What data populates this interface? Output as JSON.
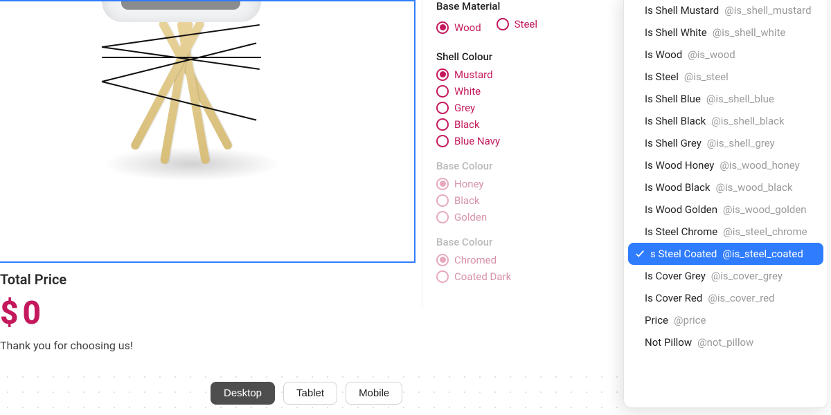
{
  "price": {
    "title": "Total Price",
    "currency": "$",
    "value": "0",
    "thanks": "Thank you for choosing us!"
  },
  "options": {
    "base_material": {
      "label": "Base Material",
      "items": [
        {
          "label": "Wood",
          "selected": true
        },
        {
          "label": "Steel",
          "selected": false
        }
      ]
    },
    "shell_colour": {
      "label": "Shell Colour",
      "items": [
        {
          "label": "Mustard",
          "selected": true
        },
        {
          "label": "White",
          "selected": false
        },
        {
          "label": "Grey",
          "selected": false
        },
        {
          "label": "Black",
          "selected": false
        },
        {
          "label": "Blue Navy",
          "selected": false
        }
      ]
    },
    "base_colour_wood": {
      "label": "Base Colour",
      "muted": true,
      "items": [
        {
          "label": "Honey",
          "selected": true
        },
        {
          "label": "Black",
          "selected": false
        },
        {
          "label": "Golden",
          "selected": false
        }
      ]
    },
    "base_colour_steel": {
      "label": "Base Colour",
      "muted": true,
      "items": [
        {
          "label": "Chromed",
          "selected": true
        },
        {
          "label": "Coated Dark",
          "selected": false
        }
      ]
    }
  },
  "viewbar": {
    "desktop": "Desktop",
    "tablet": "Tablet",
    "mobile": "Mobile",
    "active": "desktop"
  },
  "variables": [
    {
      "label": "Is Shell Mustard",
      "id": "@is_shell_mustard",
      "selected": false
    },
    {
      "label": "Is Shell White",
      "id": "@is_shell_white",
      "selected": false
    },
    {
      "label": "Is Wood",
      "id": "@is_wood",
      "selected": false
    },
    {
      "label": "Is Steel",
      "id": "@is_steel",
      "selected": false
    },
    {
      "label": "Is Shell Blue",
      "id": "@is_shell_blue",
      "selected": false
    },
    {
      "label": "Is Shell Black",
      "id": "@is_shell_black",
      "selected": false
    },
    {
      "label": "Is Shell Grey",
      "id": "@is_shell_grey",
      "selected": false
    },
    {
      "label": "Is Wood Honey",
      "id": "@is_wood_honey",
      "selected": false
    },
    {
      "label": "Is Wood Black",
      "id": "@is_wood_black",
      "selected": false
    },
    {
      "label": "Is Wood Golden",
      "id": "@is_wood_golden",
      "selected": false
    },
    {
      "label": "Is Steel Chrome",
      "id": "@is_steel_chrome",
      "selected": false
    },
    {
      "label": "Is Steel Coated",
      "id": "@is_steel_coated",
      "selected": true
    },
    {
      "label": "Is Cover Grey",
      "id": "@is_cover_grey",
      "selected": false
    },
    {
      "label": "Is Cover Red",
      "id": "@is_cover_red",
      "selected": false
    },
    {
      "label": "Price",
      "id": "@price",
      "selected": false
    },
    {
      "label": "Not Pillow",
      "id": "@not_pillow",
      "selected": false
    }
  ]
}
